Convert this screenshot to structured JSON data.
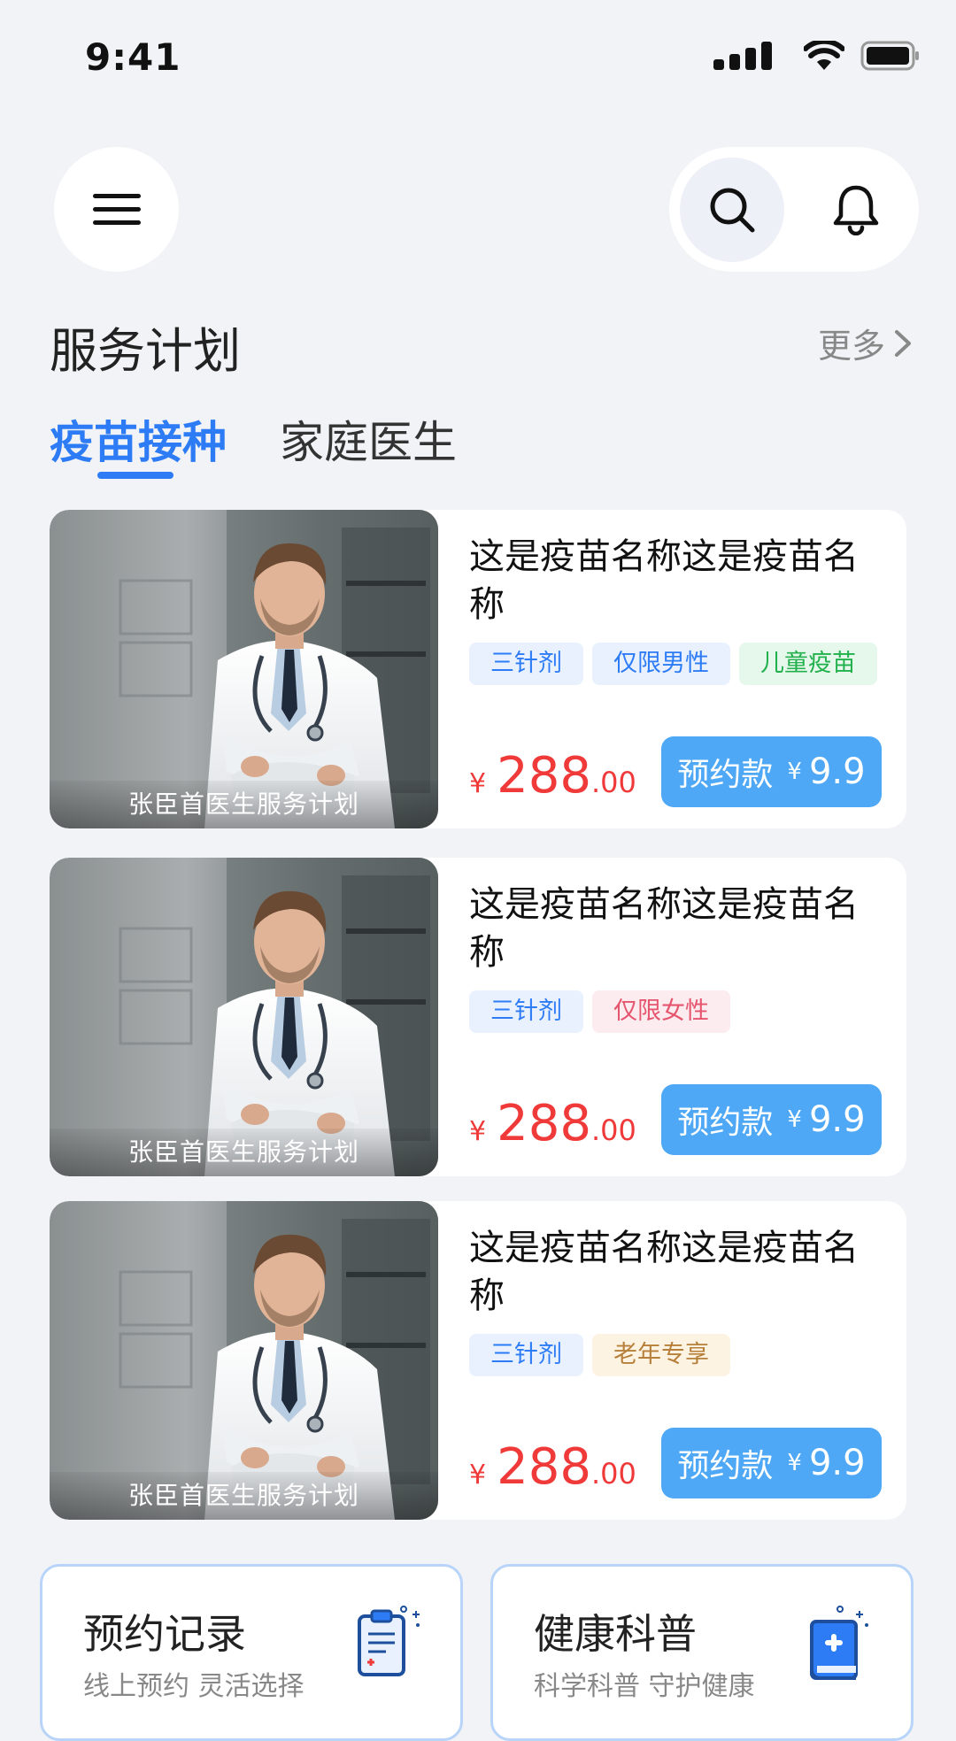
{
  "status_bar": {
    "time": "9:41"
  },
  "header": {
    "menu_icon": "hamburger-menu-icon",
    "search_icon": "search-icon",
    "bell_icon": "bell-icon"
  },
  "section": {
    "title": "服务计划",
    "more_label": "更多"
  },
  "tabs": [
    {
      "label": "疫苗接种",
      "active": true
    },
    {
      "label": "家庭医生",
      "active": false
    }
  ],
  "cards": [
    {
      "title": "这是疫苗名称这是疫苗名称",
      "image_caption": "张臣首医生服务计划",
      "tags": [
        {
          "label": "三针剂",
          "color": "blue"
        },
        {
          "label": "仅限男性",
          "color": "blue"
        },
        {
          "label": "儿童疫苗",
          "color": "green"
        }
      ],
      "price_currency": "¥",
      "price_integer": "288",
      "price_decimal": ".00",
      "button_label": "预约款",
      "button_currency": "¥",
      "button_amount": "9.9"
    },
    {
      "title": "这是疫苗名称这是疫苗名称",
      "image_caption": "张臣首医生服务计划",
      "tags": [
        {
          "label": "三针剂",
          "color": "blue"
        },
        {
          "label": "仅限女性",
          "color": "pink"
        }
      ],
      "price_currency": "¥",
      "price_integer": "288",
      "price_decimal": ".00",
      "button_label": "预约款",
      "button_currency": "¥",
      "button_amount": "9.9"
    },
    {
      "title": "这是疫苗名称这是疫苗名称",
      "image_caption": "张臣首医生服务计划",
      "tags": [
        {
          "label": "三针剂",
          "color": "blue"
        },
        {
          "label": "老年专享",
          "color": "beige"
        }
      ],
      "price_currency": "¥",
      "price_integer": "288",
      "price_decimal": ".00",
      "button_label": "预约款",
      "button_currency": "¥",
      "button_amount": "9.9"
    }
  ],
  "bottom_cards": [
    {
      "title": "预约记录",
      "subtitle": "线上预约 灵活选择",
      "icon": "clipboard-icon"
    },
    {
      "title": "健康科普",
      "subtitle": "科学科普 守护健康",
      "icon": "medical-book-icon"
    }
  ],
  "colors": {
    "accent": "#2d7cf6",
    "price": "#f03a3a",
    "button": "#4ea8f6",
    "background": "#f2f3f7"
  }
}
